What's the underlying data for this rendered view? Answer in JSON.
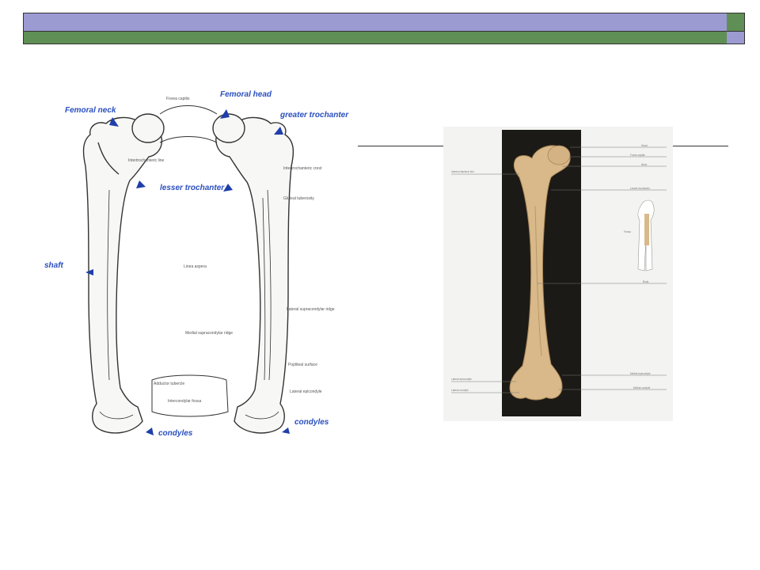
{
  "colors": {
    "bar_lavender": "#9b9ad1",
    "bar_green": "#5f8f55",
    "label_blue": "#2a4fbf",
    "photo_bg": "#1c1a16",
    "bone_color": "#d9b98a"
  },
  "left_figure": {
    "labels_blue": {
      "femoral_neck": "Femoral neck",
      "femoral_head": "Femoral head",
      "greater_trochanter": "greater trochanter",
      "lesser_trochanter": "lesser trochanter",
      "shaft": "shaft",
      "condyles_left": "condyles",
      "condyles_right": "condyles"
    },
    "labels_small": {
      "fovea_capitis": "Fovea capitis",
      "intertrochanteric_line": "Intertrochanteric line",
      "intertrochanteric_crest": "Intertrochanteric crest",
      "gluteal_tuberosity": "Gluteal tuberosity",
      "linea_aspera": "Linea aspera",
      "lateral_supracondylar_ridge": "Lateral supracondylar ridge",
      "medial_supracondylar_ridge": "Medial supracondylar ridge",
      "popliteal_surface": "Popliteal surface",
      "lateral_epicondyle": "Lateral epicondyle",
      "adductor_tubercle": "Adductor tubercle",
      "intercondylar_fossa": "Intercondylar fossa"
    }
  },
  "right_figure": {
    "left_labels": {
      "intertrochanteric_line": "Intertrochanteric line",
      "lateral_epicondyle": "Lateral epicondyle",
      "lateral_condyle": "Lateral condyle"
    },
    "right_labels": {
      "head": "Head",
      "fovea_capitis": "Fovea capitis",
      "neck": "Neck",
      "lesser_trochanter": "Lesser trochanter",
      "body": "Body",
      "medial_epicondyle": "Medial epicondyle",
      "medial_condyle": "Medial condyle",
      "femur": "Femur"
    }
  }
}
